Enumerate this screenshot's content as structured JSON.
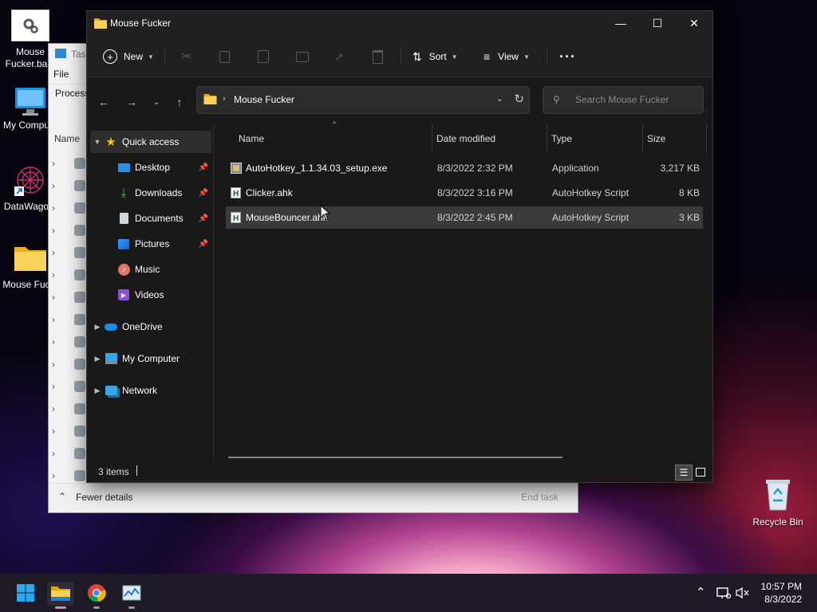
{
  "desktop": {
    "icons": [
      {
        "label_line1": "Mouse",
        "label_line2": "Fucker.ba..."
      },
      {
        "label_line1": "My Compu..."
      },
      {
        "label_line1": "DataWago..."
      },
      {
        "label_line1": "Mouse Fuc..."
      },
      {
        "label_line1": "Recycle Bin"
      }
    ]
  },
  "task_manager": {
    "title": "Task",
    "menu": [
      "File",
      "O"
    ],
    "tab": "Process",
    "column": "Name",
    "fewer_details": "Fewer details",
    "end_task": "End task"
  },
  "explorer": {
    "title": "Mouse Fucker",
    "toolbar": {
      "new_label": "New",
      "sort_label": "Sort",
      "view_label": "View",
      "more_label": "···"
    },
    "address": {
      "path": "Mouse Fucker",
      "search_placeholder": "Search Mouse Fucker"
    },
    "sidebar": [
      {
        "label": "Quick access",
        "icon": "star-icon"
      },
      {
        "label": "Desktop",
        "icon": "desktop-icon"
      },
      {
        "label": "Downloads",
        "icon": "download-icon"
      },
      {
        "label": "Documents",
        "icon": "document-icon"
      },
      {
        "label": "Pictures",
        "icon": "picture-icon"
      },
      {
        "label": "Music",
        "icon": "music-icon"
      },
      {
        "label": "Videos",
        "icon": "video-icon"
      },
      {
        "label": "OneDrive",
        "icon": "cloud-icon"
      },
      {
        "label": "My Computer",
        "icon": "computer-icon"
      },
      {
        "label": "Network",
        "icon": "network-icon"
      }
    ],
    "columns": {
      "name": "Name",
      "date": "Date modified",
      "type": "Type",
      "size": "Size"
    },
    "files": [
      {
        "name": "AutoHotkey_1.1.34.03_setup.exe",
        "date": "8/3/2022 2:32 PM",
        "type": "Application",
        "size": "3,217 KB"
      },
      {
        "name": "Clicker.ahk",
        "date": "8/3/2022 3:16 PM",
        "type": "AutoHotkey Script",
        "size": "8 KB"
      },
      {
        "name": "MouseBouncer.ahk",
        "date": "8/3/2022 2:45 PM",
        "type": "AutoHotkey Script",
        "size": "3 KB"
      }
    ],
    "status": {
      "item_count": "3 items"
    }
  },
  "taskbar": {
    "time": "10:57 PM",
    "date": "8/3/2022"
  },
  "colors": {
    "accent_folder": "#f4c842",
    "selection": "#3a3a3a",
    "window_bg": "#191919"
  }
}
